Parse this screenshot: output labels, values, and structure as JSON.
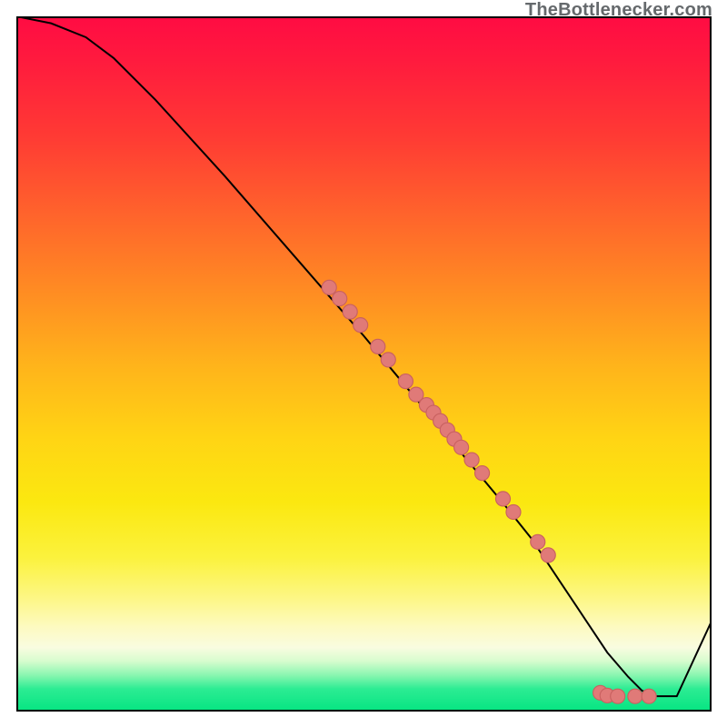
{
  "attribution": "TheBottlenecker.com",
  "colors": {
    "curve": "#000000",
    "scatter_fill": "#e07a78",
    "scatter_stroke": "#c96160"
  },
  "chart_data": {
    "type": "line",
    "title": "",
    "xlabel": "",
    "ylabel": "",
    "xlim": [
      0,
      100
    ],
    "ylim": [
      0,
      100
    ],
    "series": [
      {
        "name": "curve",
        "x": [
          0,
          5,
          10,
          14,
          20,
          30,
          40,
          50,
          55,
          60,
          65,
          70,
          74,
          78,
          82,
          85,
          88,
          90,
          92,
          95,
          100
        ],
        "y": [
          100,
          99,
          97,
          94,
          88,
          77,
          65.5,
          54,
          48,
          42,
          36,
          30,
          25,
          19,
          13,
          8.5,
          5,
          3,
          2.2,
          2.2,
          13
        ]
      }
    ],
    "scatter": [
      {
        "x": 45,
        "y": 61
      },
      {
        "x": 46.5,
        "y": 59.4
      },
      {
        "x": 48,
        "y": 57.5
      },
      {
        "x": 49.5,
        "y": 55.6
      },
      {
        "x": 52,
        "y": 52.5
      },
      {
        "x": 53.5,
        "y": 50.6
      },
      {
        "x": 56,
        "y": 47.5
      },
      {
        "x": 57.5,
        "y": 45.6
      },
      {
        "x": 59,
        "y": 44.1
      },
      {
        "x": 60,
        "y": 43
      },
      {
        "x": 61,
        "y": 41.8
      },
      {
        "x": 62,
        "y": 40.5
      },
      {
        "x": 63,
        "y": 39.2
      },
      {
        "x": 64,
        "y": 38
      },
      {
        "x": 65.5,
        "y": 36.2
      },
      {
        "x": 67,
        "y": 34.3
      },
      {
        "x": 70,
        "y": 30.6
      },
      {
        "x": 71.5,
        "y": 28.7
      },
      {
        "x": 75,
        "y": 24.4
      },
      {
        "x": 76.5,
        "y": 22.5
      },
      {
        "x": 84,
        "y": 2.7
      },
      {
        "x": 85,
        "y": 2.3
      },
      {
        "x": 86.5,
        "y": 2.2
      },
      {
        "x": 89,
        "y": 2.2
      },
      {
        "x": 91,
        "y": 2.2
      }
    ]
  }
}
